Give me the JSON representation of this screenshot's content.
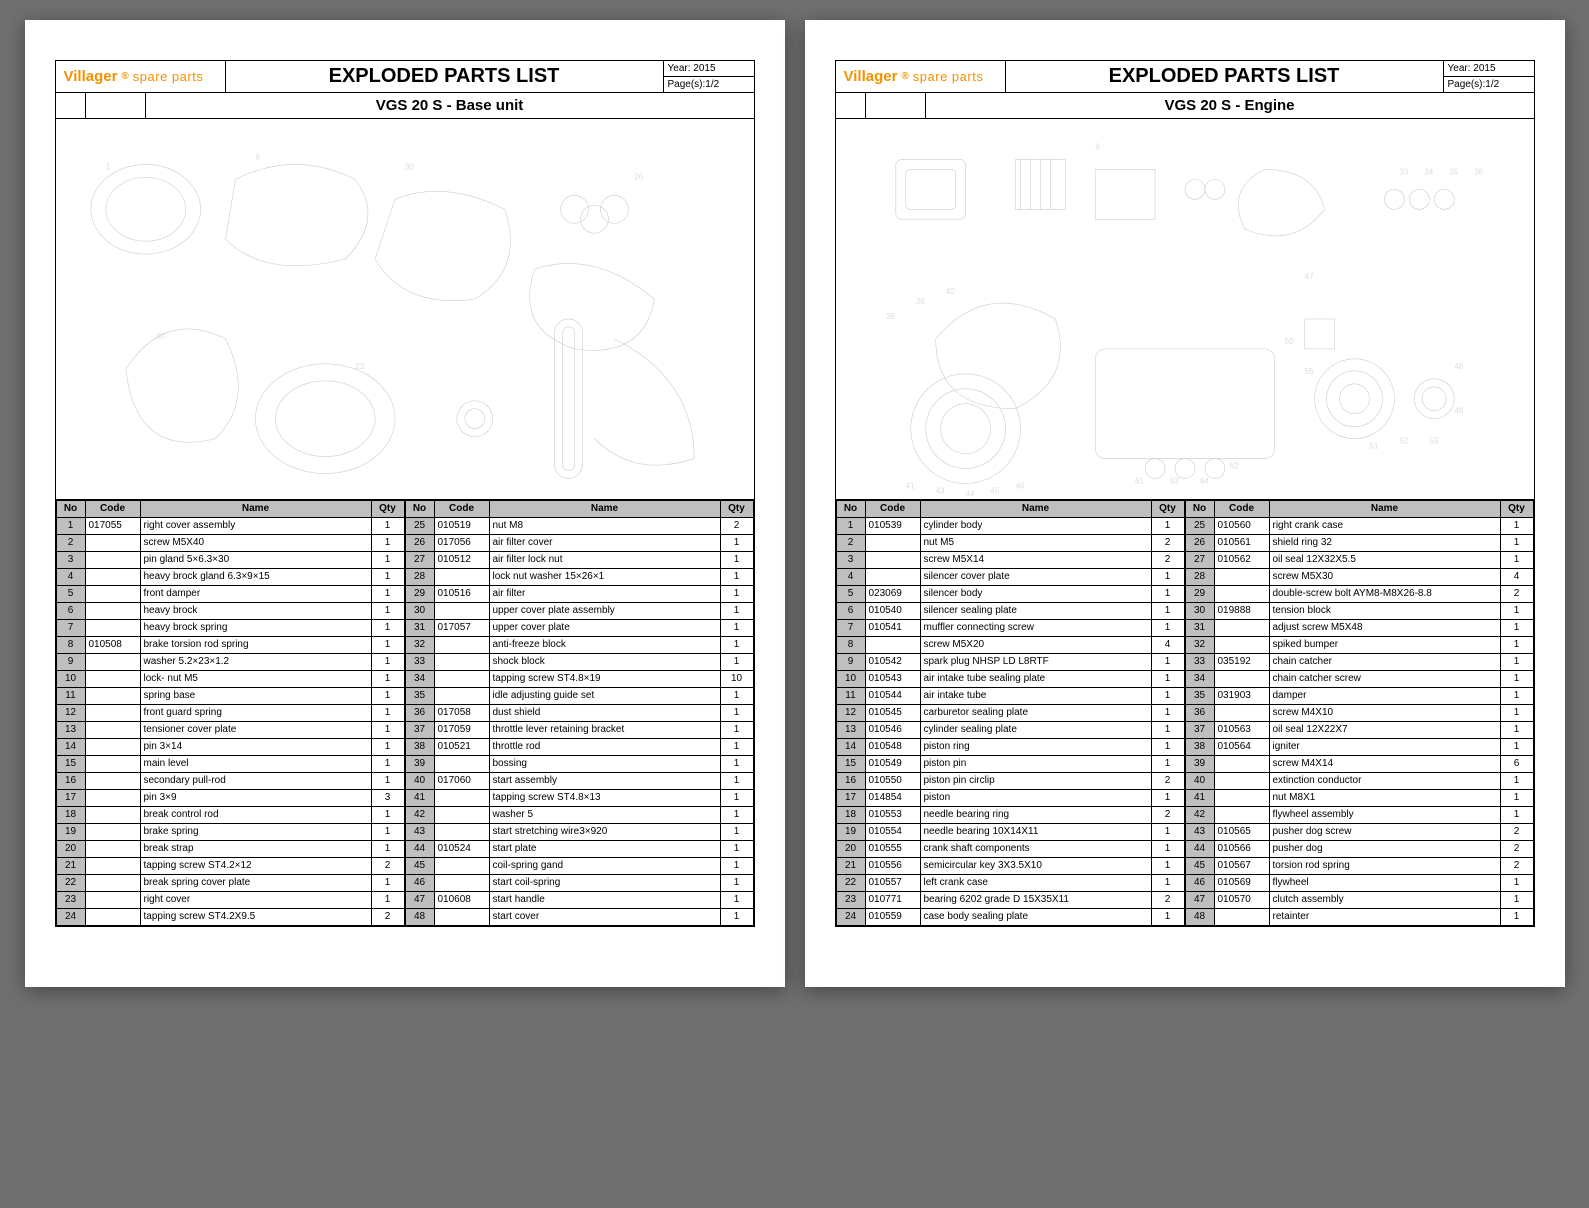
{
  "brand_main": "Villager",
  "brand_reg": "®",
  "brand_sub": "spare parts",
  "title": "EXPLODED PARTS LIST",
  "year_label": "Year: 2015",
  "pages_label": "Page(s):1/2",
  "th_no": "No",
  "th_code": "Code",
  "th_name": "Name",
  "th_qty": "Qty",
  "pages": [
    {
      "subtitle": "VGS 20 S - Base unit",
      "left": [
        {
          "no": 1,
          "code": "017055",
          "name": "right cover assembly",
          "qty": 1
        },
        {
          "no": 2,
          "code": "",
          "name": "screw M5X40",
          "qty": 1
        },
        {
          "no": 3,
          "code": "",
          "name": "pin gland 5×6.3×30",
          "qty": 1
        },
        {
          "no": 4,
          "code": "",
          "name": "heavy brock gland 6.3×9×15",
          "qty": 1
        },
        {
          "no": 5,
          "code": "",
          "name": "front damper",
          "qty": 1
        },
        {
          "no": 6,
          "code": "",
          "name": "heavy brock",
          "qty": 1
        },
        {
          "no": 7,
          "code": "",
          "name": "heavy brock spring",
          "qty": 1
        },
        {
          "no": 8,
          "code": "010508",
          "name": "brake torsion rod spring",
          "qty": 1
        },
        {
          "no": 9,
          "code": "",
          "name": "washer 5.2×23×1.2",
          "qty": 1
        },
        {
          "no": 10,
          "code": "",
          "name": "lock- nut M5",
          "qty": 1
        },
        {
          "no": 11,
          "code": "",
          "name": "spring base",
          "qty": 1
        },
        {
          "no": 12,
          "code": "",
          "name": "front guard spring",
          "qty": 1
        },
        {
          "no": 13,
          "code": "",
          "name": "tensioner cover plate",
          "qty": 1
        },
        {
          "no": 14,
          "code": "",
          "name": "pin 3×14",
          "qty": 1
        },
        {
          "no": 15,
          "code": "",
          "name": "main level",
          "qty": 1
        },
        {
          "no": 16,
          "code": "",
          "name": "secondary pull-rod",
          "qty": 1
        },
        {
          "no": 17,
          "code": "",
          "name": "pin 3×9",
          "qty": 3
        },
        {
          "no": 18,
          "code": "",
          "name": "break control rod",
          "qty": 1
        },
        {
          "no": 19,
          "code": "",
          "name": "brake  spring",
          "qty": 1
        },
        {
          "no": 20,
          "code": "",
          "name": "break strap",
          "qty": 1
        },
        {
          "no": 21,
          "code": "",
          "name": "tapping screw ST4.2×12",
          "qty": 2
        },
        {
          "no": 22,
          "code": "",
          "name": "break spring cover plate",
          "qty": 1
        },
        {
          "no": 23,
          "code": "",
          "name": "right cover",
          "qty": 1
        },
        {
          "no": 24,
          "code": "",
          "name": "tapping screw ST4.2X9.5",
          "qty": 2
        }
      ],
      "right": [
        {
          "no": 25,
          "code": "010519",
          "name": "nut M8",
          "qty": 2
        },
        {
          "no": 26,
          "code": "017056",
          "name": "air filter cover",
          "qty": 1
        },
        {
          "no": 27,
          "code": "010512",
          "name": "air filter lock nut",
          "qty": 1
        },
        {
          "no": 28,
          "code": "",
          "name": "lock nut washer 15×26×1",
          "qty": 1
        },
        {
          "no": 29,
          "code": "010516",
          "name": "air filter",
          "qty": 1
        },
        {
          "no": 30,
          "code": "",
          "name": "upper cover plate assembly",
          "qty": 1
        },
        {
          "no": 31,
          "code": "017057",
          "name": "upper cover plate",
          "qty": 1
        },
        {
          "no": 32,
          "code": "",
          "name": "anti-freeze block",
          "qty": 1
        },
        {
          "no": 33,
          "code": "",
          "name": "shock block",
          "qty": 1
        },
        {
          "no": 34,
          "code": "",
          "name": "tapping screw ST4.8×19",
          "qty": 10
        },
        {
          "no": 35,
          "code": "",
          "name": "idle adjusting guide set",
          "qty": 1
        },
        {
          "no": 36,
          "code": "017058",
          "name": "dust shield",
          "qty": 1
        },
        {
          "no": 37,
          "code": "017059",
          "name": "throttle lever retaining bracket",
          "qty": 1
        },
        {
          "no": 38,
          "code": "010521",
          "name": "throttle rod",
          "qty": 1
        },
        {
          "no": 39,
          "code": "",
          "name": "bossing",
          "qty": 1
        },
        {
          "no": 40,
          "code": "017060",
          "name": "start assembly",
          "qty": 1
        },
        {
          "no": 41,
          "code": "",
          "name": "tapping screw ST4.8×13",
          "qty": 1
        },
        {
          "no": 42,
          "code": "",
          "name": "washer 5",
          "qty": 1
        },
        {
          "no": 43,
          "code": "",
          "name": "start stretching wire3×920",
          "qty": 1
        },
        {
          "no": 44,
          "code": "010524",
          "name": "start plate",
          "qty": 1
        },
        {
          "no": 45,
          "code": "",
          "name": "coil-spring gand",
          "qty": 1
        },
        {
          "no": 46,
          "code": "",
          "name": "start coil-spring",
          "qty": 1
        },
        {
          "no": 47,
          "code": "010608",
          "name": "start handle",
          "qty": 1
        },
        {
          "no": 48,
          "code": "",
          "name": "start  cover",
          "qty": 1
        }
      ]
    },
    {
      "subtitle": "VGS 20 S - Engine",
      "left": [
        {
          "no": 1,
          "code": "010539",
          "name": "cylinder body",
          "qty": 1
        },
        {
          "no": 2,
          "code": "",
          "name": "nut M5",
          "qty": 2
        },
        {
          "no": 3,
          "code": "",
          "name": "screw M5X14",
          "qty": 2
        },
        {
          "no": 4,
          "code": "",
          "name": "silencer cover plate",
          "qty": 1
        },
        {
          "no": 5,
          "code": "023069",
          "name": "silencer body",
          "qty": 1
        },
        {
          "no": 6,
          "code": "010540",
          "name": "silencer sealing plate",
          "qty": 1
        },
        {
          "no": 7,
          "code": "010541",
          "name": "muffler connecting screw",
          "qty": 1
        },
        {
          "no": 8,
          "code": "",
          "name": "screw M5X20",
          "qty": 4
        },
        {
          "no": 9,
          "code": "010542",
          "name": "spark plug NHSP LD L8RTF",
          "qty": 1
        },
        {
          "no": 10,
          "code": "010543",
          "name": "air intake tube sealing plate",
          "qty": 1
        },
        {
          "no": 11,
          "code": "010544",
          "name": "air intake tube",
          "qty": 1
        },
        {
          "no": 12,
          "code": "010545",
          "name": "carburetor sealing plate",
          "qty": 1
        },
        {
          "no": 13,
          "code": "010546",
          "name": "cylinder sealing plate",
          "qty": 1
        },
        {
          "no": 14,
          "code": "010548",
          "name": "piston ring",
          "qty": 1
        },
        {
          "no": 15,
          "code": "010549",
          "name": "piston pin",
          "qty": 1
        },
        {
          "no": 16,
          "code": "010550",
          "name": "piston pin circlip",
          "qty": 2
        },
        {
          "no": 17,
          "code": "014854",
          "name": "piston",
          "qty": 1
        },
        {
          "no": 18,
          "code": "010553",
          "name": "needle bearing ring",
          "qty": 2
        },
        {
          "no": 19,
          "code": "010554",
          "name": "needle bearing 10X14X11",
          "qty": 1
        },
        {
          "no": 20,
          "code": "010555",
          "name": "crank shaft components",
          "qty": 1
        },
        {
          "no": 21,
          "code": "010556",
          "name": "semicircular key 3X3.5X10",
          "qty": 1
        },
        {
          "no": 22,
          "code": "010557",
          "name": "left crank case",
          "qty": 1
        },
        {
          "no": 23,
          "code": "010771",
          "name": "bearing 6202 grade D 15X35X11",
          "qty": 2
        },
        {
          "no": 24,
          "code": "010559",
          "name": "case body sealing plate",
          "qty": 1
        }
      ],
      "right": [
        {
          "no": 25,
          "code": "010560",
          "name": "right crank case",
          "qty": 1
        },
        {
          "no": 26,
          "code": "010561",
          "name": "shield ring 32",
          "qty": 1
        },
        {
          "no": 27,
          "code": "010562",
          "name": "oil seal 12X32X5.5",
          "qty": 1
        },
        {
          "no": 28,
          "code": "",
          "name": "screw M5X30",
          "qty": 4
        },
        {
          "no": 29,
          "code": "",
          "name": "double-screw bolt AYM8-M8X26-8.8",
          "qty": 2
        },
        {
          "no": 30,
          "code": "019888",
          "name": "tension block",
          "qty": 1
        },
        {
          "no": 31,
          "code": "",
          "name": "adjust screw M5X48",
          "qty": 1
        },
        {
          "no": 32,
          "code": "",
          "name": "spiked bumper",
          "qty": 1
        },
        {
          "no": 33,
          "code": "035192",
          "name": "chain catcher",
          "qty": 1
        },
        {
          "no": 34,
          "code": "",
          "name": "chain catcher screw",
          "qty": 1
        },
        {
          "no": 35,
          "code": "031903",
          "name": "damper",
          "qty": 1
        },
        {
          "no": 36,
          "code": "",
          "name": "screw M4X10",
          "qty": 1
        },
        {
          "no": 37,
          "code": "010563",
          "name": "oil seal 12X22X7",
          "qty": 1
        },
        {
          "no": 38,
          "code": "010564",
          "name": "igniter",
          "qty": 1
        },
        {
          "no": 39,
          "code": "",
          "name": "screw M4X14",
          "qty": 6
        },
        {
          "no": 40,
          "code": "",
          "name": "extinction conductor",
          "qty": 1
        },
        {
          "no": 41,
          "code": "",
          "name": "nut M8X1",
          "qty": 1
        },
        {
          "no": 42,
          "code": "",
          "name": "flywheel assembly",
          "qty": 1
        },
        {
          "no": 43,
          "code": "010565",
          "name": "pusher dog screw",
          "qty": 2
        },
        {
          "no": 44,
          "code": "010566",
          "name": "pusher dog",
          "qty": 2
        },
        {
          "no": 45,
          "code": "010567",
          "name": "torsion rod spring",
          "qty": 2
        },
        {
          "no": 46,
          "code": "010569",
          "name": "flywheel",
          "qty": 1
        },
        {
          "no": 47,
          "code": "010570",
          "name": "clutch assembly",
          "qty": 1
        },
        {
          "no": 48,
          "code": "",
          "name": "retainter",
          "qty": 1
        }
      ]
    }
  ]
}
